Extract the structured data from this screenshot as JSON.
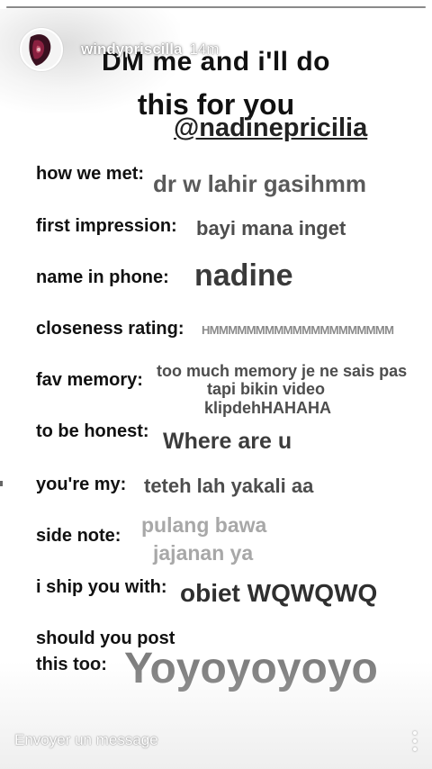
{
  "story": {
    "progress": 1.0,
    "username": "windypriscilla",
    "time_ago": "14m"
  },
  "content": {
    "title_line1": "DM me and i'll do",
    "title_line2": "this for you",
    "handle": "@nadinepricilia",
    "rows": [
      {
        "label": "how we met:",
        "answer": "dr w lahir gasihmm"
      },
      {
        "label": "first impression:",
        "answer": "bayi mana inget"
      },
      {
        "label": "name in phone:",
        "answer": "nadine"
      },
      {
        "label": "closeness rating:",
        "answer": "HMMMMMMMMMMMMMMMMMMMM"
      },
      {
        "label": "fav memory:",
        "answer_lines": [
          "too much memory je ne sais pas",
          "tapi bikin video",
          "klipdehHAHAHA"
        ]
      },
      {
        "label": "to be honest:",
        "answer": "Where are u"
      },
      {
        "label": "you're my:",
        "answer": "teteh lah yakali aa"
      },
      {
        "label": "side note:",
        "answer_lines": [
          "pulang bawa",
          "jajanan ya"
        ]
      },
      {
        "label": "i ship you with:",
        "answer": "obiet WQWQWQ"
      },
      {
        "label_lines": [
          "should you post",
          "this too:"
        ],
        "answer": "Yoyoyoyoyo"
      }
    ]
  },
  "footer": {
    "message_placeholder": "Envoyer un message",
    "more_icon": "vertical-dots-icon"
  }
}
